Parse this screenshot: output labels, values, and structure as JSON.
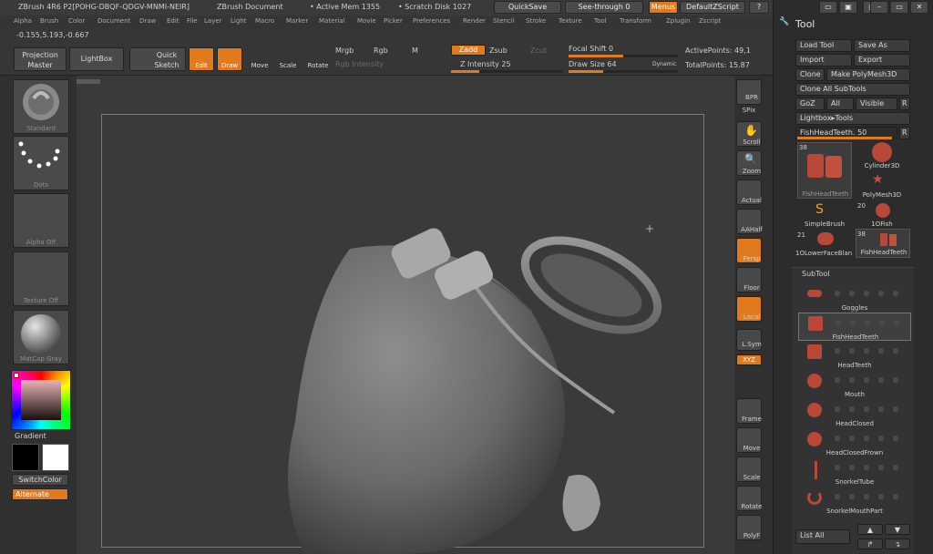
{
  "title_bar": {
    "app": "ZBrush 4R6 P2[POHG-DBQF-QDGV-MNMI-NEIR]",
    "document": "ZBrush Document",
    "active_mem": "• Active Mem 1355",
    "scratch_disk": "• Scratch Disk 1027",
    "quicksave": "QuickSave",
    "see_through": "See-through  0",
    "menus": "Menus",
    "default_zscript": "DefaultZScript"
  },
  "menu": [
    "Alpha",
    "Brush",
    "Color",
    "Document",
    "Draw",
    "Edit",
    "File",
    "Layer",
    "Light",
    "Macro",
    "Marker",
    "Material",
    "Movie",
    "Picker",
    "Preferences",
    "Render",
    "Stencil",
    "Stroke",
    "Texture",
    "Tool",
    "Transform",
    "Zplugin",
    "Zscript"
  ],
  "coords": "-0.155,5.193,-0.667",
  "toolbar": {
    "projection_master": "Projection Master",
    "lightbox": "LightBox",
    "quick_sketch": "Quick Sketch",
    "edit": "Edit",
    "draw": "Draw",
    "move": "Move",
    "scale": "Scale",
    "rotate": "Rotate",
    "mrgb": "Mrgb",
    "rgb": "Rgb",
    "m": "M",
    "rgb_intensity": "Rgb Intensity",
    "zadd": "Zadd",
    "zsub": "Zsub",
    "zcut": "Zcut",
    "z_intensity": "Z Intensity 25",
    "focal_shift": "Focal Shift 0",
    "draw_size": "Draw Size 64",
    "dynamic": "Dynamic",
    "active_points": "ActivePoints: 49,1",
    "total_points": "TotalPoints: 15.87",
    "z_intensity_value": 25,
    "focal_shift_value": 0,
    "draw_size_value": 64
  },
  "left_shelf": {
    "brush": "Standard",
    "stroke": "Dots",
    "alpha": "Alpha Off",
    "texture": "Texture Off",
    "material": "MatCap Gray",
    "gradient": "Gradient",
    "switch_color": "SwitchColor",
    "alternate": "Alternate"
  },
  "right_shelf": [
    "BPR",
    "SPix",
    "Scroll",
    "Zoom",
    "Actual",
    "AAHalf",
    "Persp",
    "Floor",
    "Local",
    "L.Sym",
    "XYZ",
    "Frame",
    "Move",
    "Scale",
    "Rotate",
    "PolyF"
  ],
  "tool_palette": {
    "title": "Tool",
    "load_tool": "Load Tool",
    "save_as": "Save As",
    "import": "Import",
    "export": "Export",
    "clone": "Clone",
    "make_polymesh": "Make PolyMesh3D",
    "clone_all": "Clone All SubTools",
    "goz": "GoZ",
    "all": "All",
    "visible": "Visible",
    "r": "R",
    "lightbox_tools": "Lightbox▸Tools",
    "current_tool": "FishHeadTeeth. 50",
    "thumbs": [
      {
        "name": "FishHeadTeeth",
        "count": "38"
      },
      {
        "name": "Cylinder3D",
        "count": ""
      },
      {
        "name": "PolyMesh3D",
        "count": ""
      },
      {
        "name": "SimpleBrush",
        "count": ""
      },
      {
        "name": "1OFish",
        "count": "20"
      },
      {
        "name": "1OLowerFaceBlan",
        "count": "21"
      },
      {
        "name": "FishHeadTeeth",
        "count": "38"
      }
    ],
    "subtool_title": "SubTool",
    "subtools": [
      "Goggles",
      "FishHeadTeeth",
      "HeadTeeth",
      "Mouth",
      "HeadClosed",
      "HeadClosedFrown",
      "SnorkelTube",
      "SnorkelMouthPart"
    ],
    "list_all": "List All"
  },
  "colors": {
    "accent": "#e07a1c",
    "panel": "#2c2c2c",
    "canvas": "#3a3a3a"
  }
}
